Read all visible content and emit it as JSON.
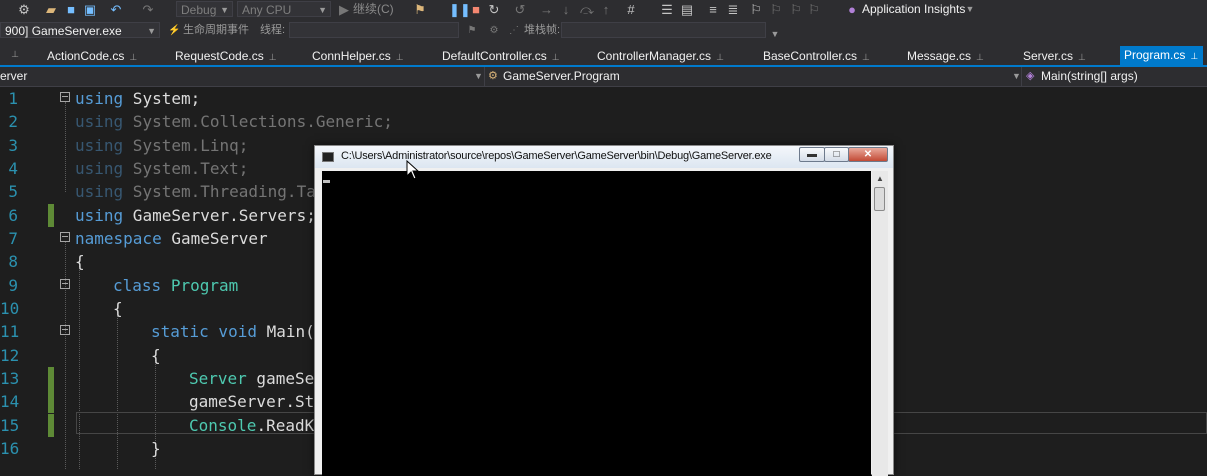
{
  "toolbar": {
    "config": "Debug",
    "platform": "Any CPU",
    "continue_label": "继续(C)",
    "app_insights": "Application Insights",
    "process": "900] GameServer.exe",
    "lifecycle_label": "生命周期事件",
    "thread_label": "线程:",
    "stackframe_label": "堆栈帧:"
  },
  "tabs": [
    {
      "label": "ActionCode.cs",
      "active": false
    },
    {
      "label": "RequestCode.cs",
      "active": false
    },
    {
      "label": "ConnHelper.cs",
      "active": false
    },
    {
      "label": "DefaultController.cs",
      "active": false
    },
    {
      "label": "ControllerManager.cs",
      "active": false
    },
    {
      "label": "BaseController.cs",
      "active": false
    },
    {
      "label": "Message.cs",
      "active": false
    },
    {
      "label": "Server.cs",
      "active": false
    },
    {
      "label": "Program.cs",
      "active": true
    }
  ],
  "navbar": {
    "project": "erver",
    "class": "GameServer.Program",
    "member": "Main(string[] args)"
  },
  "editor": {
    "line_numbers": [
      "1",
      "2",
      "3",
      "4",
      "5",
      "6",
      "7",
      "8",
      "9",
      "10",
      "11",
      "12",
      "13",
      "14",
      "15",
      "16"
    ],
    "l1a": "using",
    "l1b": " System;",
    "l2a": "using",
    "l2b": " System.Collections.Generic;",
    "l3a": "using",
    "l3b": " System.Linq;",
    "l4a": "using",
    "l4b": " System.Text;",
    "l5a": "using",
    "l5b": " System.Threading.Ta",
    "l6a": "using",
    "l6b": " GameServer.Servers;",
    "l7a": "namespace",
    "l7b": " GameServer",
    "l8": "{",
    "l9a": "class",
    "l9b": "Program",
    "l10": "{",
    "l11a": "static void",
    "l11b": " Main(",
    "l12": "{",
    "l13a": "Server",
    "l13b": " gameSe",
    "l14": "gameServer.St",
    "l15a": "Console",
    "l15b": ".ReadK",
    "l16": "}"
  },
  "console": {
    "title": "C:\\Users\\Administrator\\source\\repos\\GameServer\\GameServer\\bin\\Debug\\GameServer.exe"
  }
}
